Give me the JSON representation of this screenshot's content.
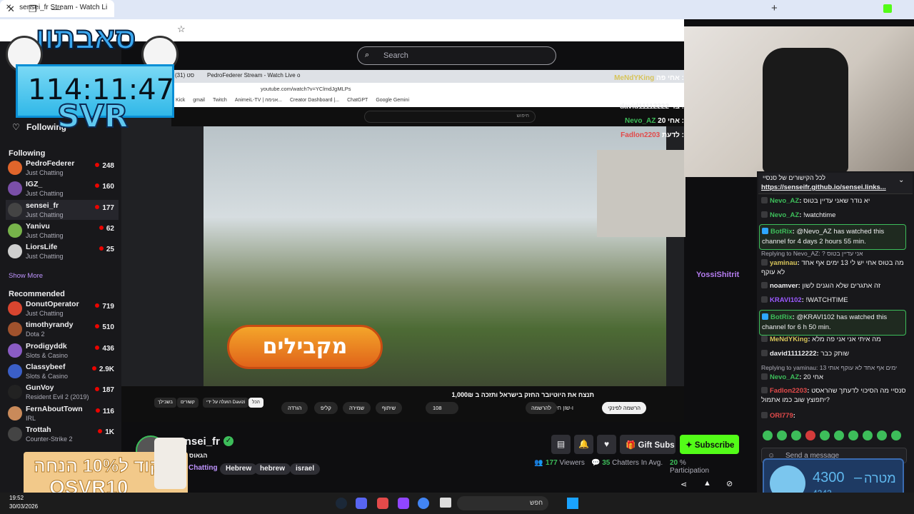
{
  "browser": {
    "right_tab_title": "sensei_fr Stream - Watch Li",
    "inner_tabs": [
      "סט (31)",
      "PedroFederer Stream - Watch Live o"
    ],
    "inner_url": "youtube.com/watch?v=YClmdJgMLPs",
    "bookmarks": [
      "Kick",
      "gmail",
      "Twitch",
      "AnimeiL-TV | אנימה...",
      "Creator Dashboard |...",
      "ChatGPT",
      "Google Gemini"
    ],
    "yt_search_placeholder": "חיפוש"
  },
  "overlay": {
    "big_title": "סאבתון",
    "timer": "114:11:47",
    "svr": "SVR",
    "promo_line1": "קוד ל10% הנחה",
    "promo_line2": "OSVR10",
    "goal_amount": "4300",
    "goal_dash": "–",
    "goal_label": "מטרה",
    "goal_current": "4242"
  },
  "twitch": {
    "search_placeholder": "Search",
    "following_label": "Following",
    "following_header": "Following",
    "show_more": "Show More",
    "recommended_header": "Recommended",
    "following": [
      {
        "name": "PedroFederer",
        "game": "Just Chatting",
        "viewers": "248",
        "color": "#e0652b"
      },
      {
        "name": "IGZ_",
        "game": "Just Chatting",
        "viewers": "160",
        "color": "#7a4fa8"
      },
      {
        "name": "sensei_fr",
        "game": "Just Chatting",
        "viewers": "177",
        "color": "#444"
      },
      {
        "name": "Yanivu",
        "game": "Just Chatting",
        "viewers": "62",
        "color": "#77b34a"
      },
      {
        "name": "LiorsLife",
        "game": "Just Chatting",
        "viewers": "25",
        "color": "#cfcfcf"
      }
    ],
    "recommended": [
      {
        "name": "DonutOperator",
        "game": "Just Chatting",
        "viewers": "719",
        "color": "#d8452f"
      },
      {
        "name": "timothyrandy",
        "game": "Dota 2",
        "viewers": "510",
        "color": "#a0522d"
      },
      {
        "name": "Prodigyddk",
        "game": "Slots & Casino",
        "viewers": "436",
        "color": "#8a5cc4"
      },
      {
        "name": "Classybeef",
        "game": "Slots & Casino",
        "viewers": "2.9K",
        "color": "#3b5fc7"
      },
      {
        "name": "GunVoy",
        "game": "Resident Evil 2 (2019)",
        "viewers": "187",
        "color": "#222"
      },
      {
        "name": "FernAboutTown",
        "game": "IRL",
        "viewers": "116",
        "color": "#c98a5a"
      },
      {
        "name": "Trottah",
        "game": "Counter-Strike 2",
        "viewers": "1K",
        "color": "#444"
      }
    ],
    "channel_name": "sensei_fr",
    "channel_sub": "הגאוס איז ב",
    "category": "Chatting",
    "tags": [
      "Hebrew",
      "hebrew",
      "israel"
    ],
    "gift_subs": "Gift Subs",
    "subscribe": "Subscribe",
    "viewers": "177",
    "viewers_label": "Viewers",
    "chatters": "35",
    "chatters_label": "Chatters In Avg.",
    "participation": "20",
    "participation_label": "% Participation",
    "send_placeholder": "Send a message"
  },
  "youtube": {
    "video_caption": "מקבילים",
    "video_title": "תנצח את היוטיובר החזק בישראל ותזכה ב 1,000₪",
    "channel": "Davizi ו-שון חלבון",
    "subscribe_btn": "להרשמה",
    "subscribed_btn": "הרשמה לפינקי",
    "likes": "108",
    "actions": [
      "שיתוף",
      "שמירה",
      "קליפ",
      "הורדה"
    ],
    "chips": [
      "הכל",
      "הועלה על ידי Davizi",
      "קשורים",
      "בשבילך"
    ]
  },
  "stream_chat": [
    {
      "user": "MeNdYKing",
      "text": "אחי פה :",
      "color": "#d7c45a"
    },
    {
      "user": "",
      "text": "מלא",
      "color": "#efeff1"
    },
    {
      "user": "david11112222",
      "text": "בר :",
      "color": "#efeff1"
    },
    {
      "user": "Nevo_AZ",
      "text": "אחי 20 :",
      "color": "#3dbd5a"
    },
    {
      "user": "Fadlon2203",
      "text": "לדעת :",
      "color": "#e24a4a"
    }
  ],
  "chat": {
    "pinned_link": "https://senseifr.github.io/sensei.links...",
    "pinned_label": "לכל הקישורים של סנסיי",
    "messages": [
      {
        "user": "Nevo_AZ",
        "text": "יא נודר שאני עדיין בטוס",
        "color": "#3dbd5a"
      },
      {
        "user": "Nevo_AZ",
        "text": "!watchtime",
        "color": "#3dbd5a"
      },
      {
        "user": "BotRix",
        "text": "@Nevo_AZ has watched this channel for 4 days 2 hours 55 min.",
        "color": "#3dbd5a",
        "bot": true
      },
      {
        "reply": "Replying to Nevo_AZ: ? אני עדיין בטוס",
        "user": "yaminau",
        "text": "מה בטוס אחי יש לי 13 ימים אף אחד לא עוקף",
        "color": "#d7c45a"
      },
      {
        "user": "noamver",
        "text": "זה אתגרים שלא הוגנים לשון",
        "color": "#efeff1"
      },
      {
        "user": "KRAVI102",
        "text": "!WATCHTIME",
        "color": "#9b59ff"
      },
      {
        "user": "BotRix",
        "text": "@KRAVI102 has watched this channel for 6 h 50 min.",
        "color": "#3dbd5a",
        "bot": true
      },
      {
        "user": "MeNdYKing",
        "text": "מה איתי אני אני פה מלא",
        "color": "#d7c45a"
      },
      {
        "user": "david11112222",
        "text": "שותק כבר",
        "color": "#efeff1"
      },
      {
        "reply": "Replying to yaminau: 13 ימים אף אחד לא עוקף אותי",
        "user": "Nevo_AZ",
        "text": "אחי 20",
        "color": "#3dbd5a"
      },
      {
        "user": "Fadlon2203",
        "text": "סנסיי מה הסיכוי לדעתך שהראסט יתפוצץ שוב כמו אתמול?",
        "color": "#e24a4a"
      },
      {
        "user": "ORI779",
        "text": "",
        "color": "#e24a4a"
      }
    ],
    "floating_user": "YossiShitrit"
  },
  "taskbar": {
    "search": "חפש",
    "time": "19:52",
    "date": "30/03/2026"
  }
}
